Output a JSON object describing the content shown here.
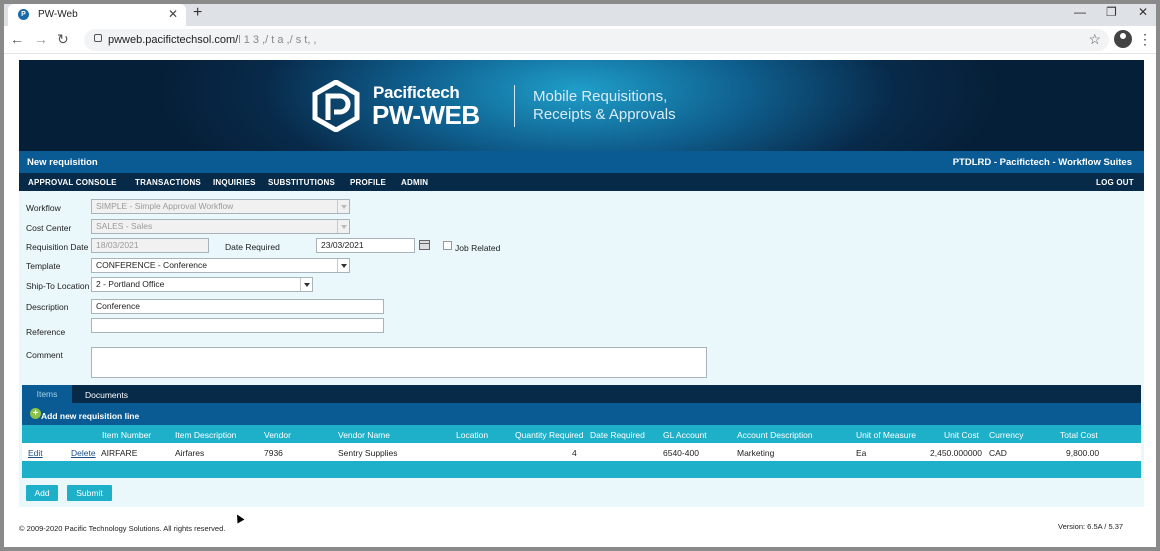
{
  "browser": {
    "tab_title": "PW-Web",
    "tab_close": "✕",
    "new_tab": "+",
    "url_host": "pwweb.pacifictechsol.com/",
    "url_path": "l 1 3 ,/ t   a ,/ s  t, ,",
    "win_min": "—",
    "win_max": "❐",
    "win_close": "✕"
  },
  "banner": {
    "brand_line1": "Pacifictech",
    "brand_line2": "PW-WEB",
    "tagline1": "Mobile Requisitions,",
    "tagline2": "Receipts & Approvals"
  },
  "titlebar": {
    "page_title": "New requisition",
    "company": "PTDLRD - Pacifictech - Workflow Suites"
  },
  "menu": {
    "items": [
      "APPROVAL CONSOLE",
      "TRANSACTIONS",
      "INQUIRIES",
      "SUBSTITUTIONS",
      "PROFILE",
      "ADMIN"
    ],
    "logout": "LOG OUT"
  },
  "form": {
    "workflow_label": "Workflow",
    "workflow_value": "SIMPLE - Simple Approval Workflow",
    "cost_center_label": "Cost Center",
    "cost_center_value": "SALES - Sales",
    "req_date_label": "Requisition Date",
    "req_date_value": "18/03/2021",
    "date_required_label": "Date Required",
    "date_required_value": "23/03/2021",
    "job_related_label": "Job Related",
    "template_label": "Template",
    "template_value": "CONFERENCE - Conference",
    "ship_to_label": "Ship-To Location",
    "ship_to_value": "2 - Portland Office",
    "description_label": "Description",
    "description_value": "Conference",
    "reference_label": "Reference",
    "reference_value": "",
    "comment_label": "Comment",
    "comment_value": ""
  },
  "grid": {
    "tabs": [
      "Items",
      "Documents"
    ],
    "add_line": "Add new requisition line",
    "columns": [
      "Item Number",
      "Item Description",
      "Vendor",
      "Vendor Name",
      "Location",
      "Quantity Required",
      "Date Required",
      "GL Account",
      "Account Description",
      "Unit of Measure",
      "Unit Cost",
      "Currency",
      "Total Cost"
    ],
    "rows": [
      {
        "edit": "Edit",
        "delete": "Delete",
        "item_number": "AIRFARE",
        "item_description": "Airfares",
        "vendor": "7936",
        "vendor_name": "Sentry Supplies",
        "location": "",
        "quantity": "4",
        "date_required": "",
        "gl_account": "6540-400",
        "account_description": "Marketing",
        "uom": "Ea",
        "unit_cost": "2,450.000000",
        "currency": "CAD",
        "total_cost": "9,800.00"
      }
    ]
  },
  "buttons": {
    "add": "Add",
    "submit": "Submit"
  },
  "footer": {
    "copyright": "© 2009-2020 Pacific Technology Solutions. All rights reserved.",
    "version": "Version: 6.5A / 5.37"
  },
  "colors": {
    "title_bar": "#0a5a93",
    "menu_bar": "#062a47",
    "grid_header": "#1fb0c9",
    "form_bg": "#eaf7fb"
  }
}
